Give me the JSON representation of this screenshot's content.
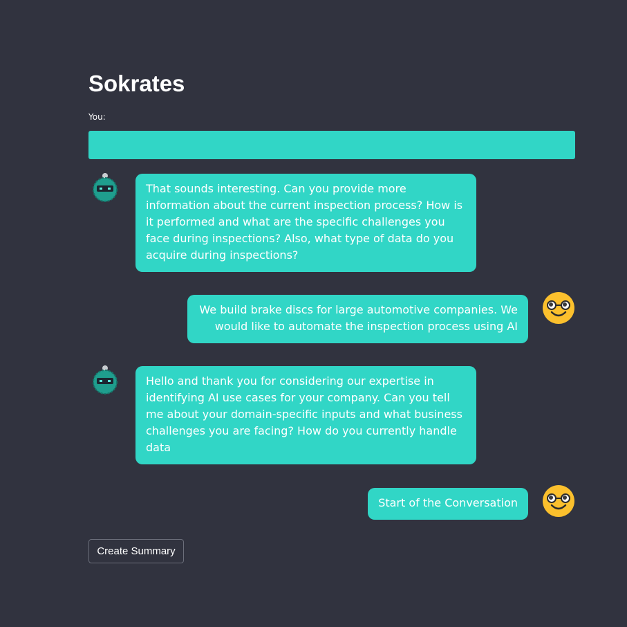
{
  "app": {
    "title": "Sokrates"
  },
  "input": {
    "label": "You:",
    "value": "",
    "accent_color": "#31d6c6"
  },
  "messages": [
    {
      "role": "bot",
      "avatar_icon": "robot-avatar-icon",
      "text": "That sounds interesting. Can you provide more information about the current inspection process? How is it performed and what are the specific challenges you face during inspections? Also, what type of data do you acquire during inspections?"
    },
    {
      "role": "user",
      "avatar_icon": "nerd-face-avatar-icon",
      "text": "We build brake discs for large automotive companies. We would like to automate the inspection process using AI"
    },
    {
      "role": "bot",
      "avatar_icon": "robot-avatar-icon",
      "text": "Hello and thank you for considering our expertise in identifying AI use cases for your company. Can you tell me about your domain-specific inputs and what business challenges you are facing? How do you currently handle data"
    },
    {
      "role": "user",
      "avatar_icon": "nerd-face-avatar-icon",
      "text": "Start of the Conversation"
    }
  ],
  "actions": {
    "summary_label": "Create Summary"
  },
  "colors": {
    "background": "#31333f",
    "bubble": "#31d6c6",
    "user_avatar": "#fbc02d"
  }
}
